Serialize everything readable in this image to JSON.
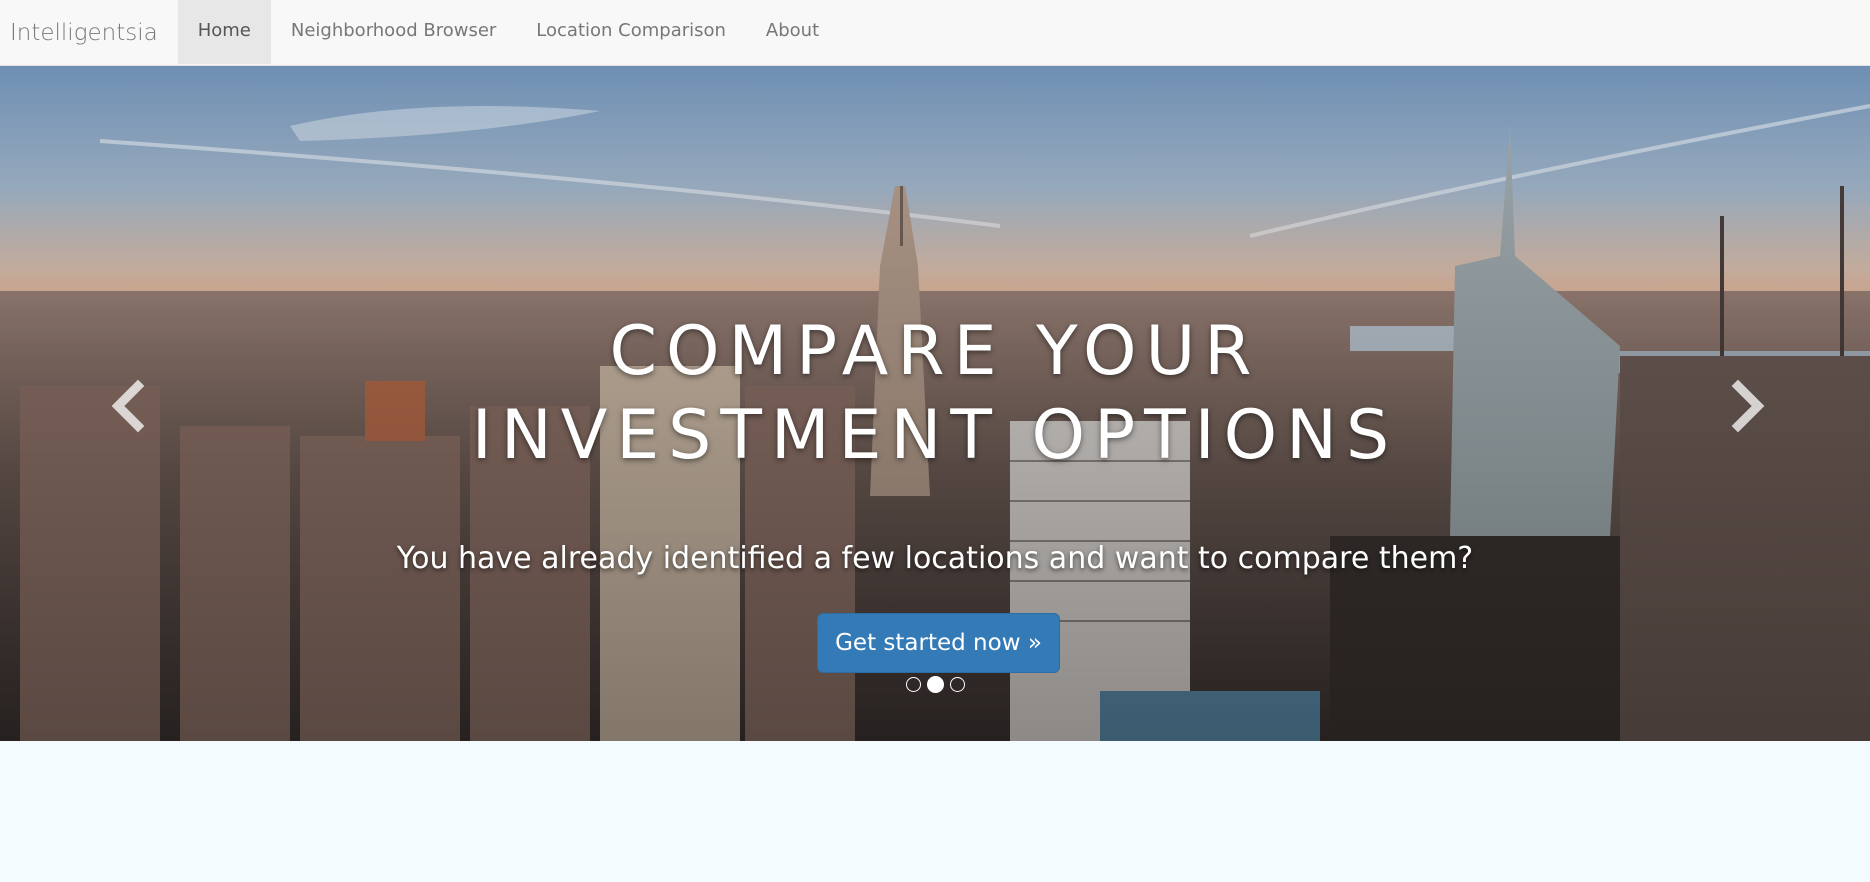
{
  "navbar": {
    "brand": "Intelligentsia",
    "items": [
      {
        "label": "Home",
        "active": true
      },
      {
        "label": "Neighborhood Browser",
        "active": false
      },
      {
        "label": "Location Comparison",
        "active": false
      },
      {
        "label": "About",
        "active": false
      }
    ]
  },
  "carousel": {
    "headline_line1": "COMPARE YOUR",
    "headline_line2": "INVESTMENT OPTIONS",
    "subtitle": "You have already identified a few locations and want to compare them?",
    "cta_label": "Get started now »",
    "slide_count": 3,
    "active_slide": 2,
    "prev_icon": "chevron-left-icon",
    "next_icon": "chevron-right-icon"
  },
  "colors": {
    "navbar_bg": "#f8f8f8",
    "nav_active_bg": "#e7e7e7",
    "cta_bg": "#337ab7",
    "page_bg": "#f4fbfe"
  }
}
